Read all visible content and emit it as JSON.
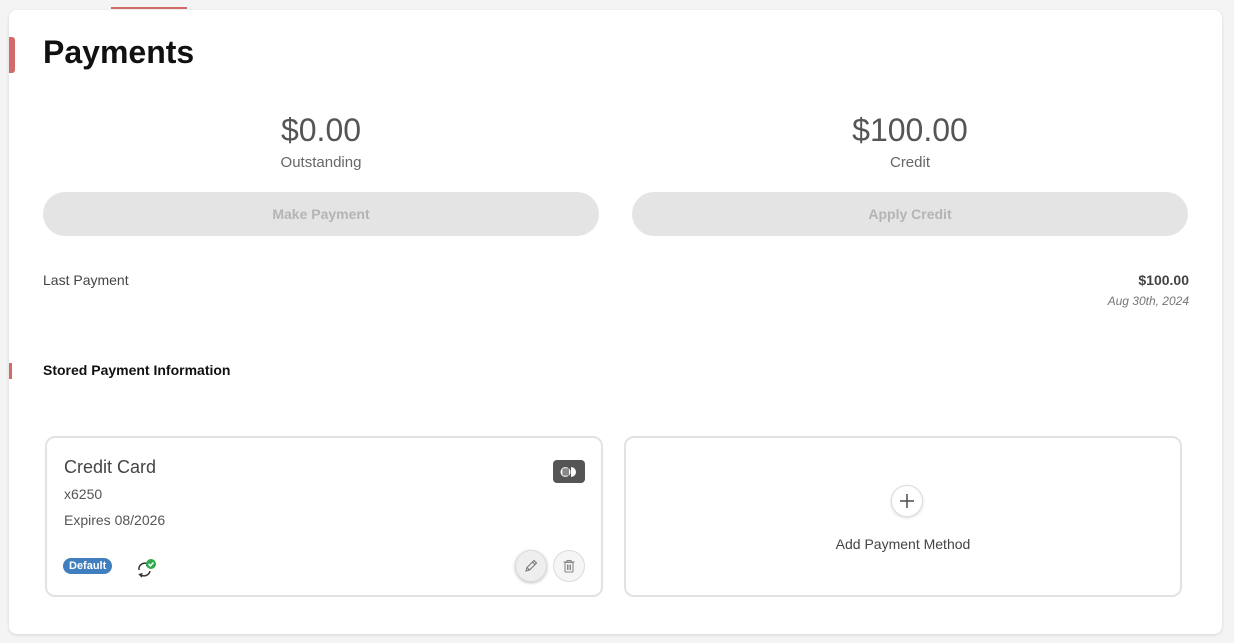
{
  "page": {
    "title": "Payments"
  },
  "summary": {
    "outstanding": {
      "amount": "$0.00",
      "label": "Outstanding"
    },
    "credit": {
      "amount": "$100.00",
      "label": "Credit"
    }
  },
  "actions": {
    "make_payment": "Make Payment",
    "apply_credit": "Apply Credit"
  },
  "last_payment": {
    "label": "Last Payment",
    "amount": "$100.00",
    "date": "Aug 30th, 2024"
  },
  "stored": {
    "title": "Stored Payment Information",
    "card": {
      "title": "Credit Card",
      "number": "x6250",
      "expiry": "Expires 08/2026",
      "badge": "Default",
      "brand_icon": "card-brand-icon",
      "autopay_icon": "autopay-enabled-icon"
    },
    "add_method": {
      "label": "Add Payment Method",
      "icon": "plus-icon"
    }
  },
  "colors": {
    "accent": "#d26a6a",
    "badge": "#3f7fbf",
    "check": "#2eaa4a",
    "disabled_button": "#e4e4e4"
  }
}
